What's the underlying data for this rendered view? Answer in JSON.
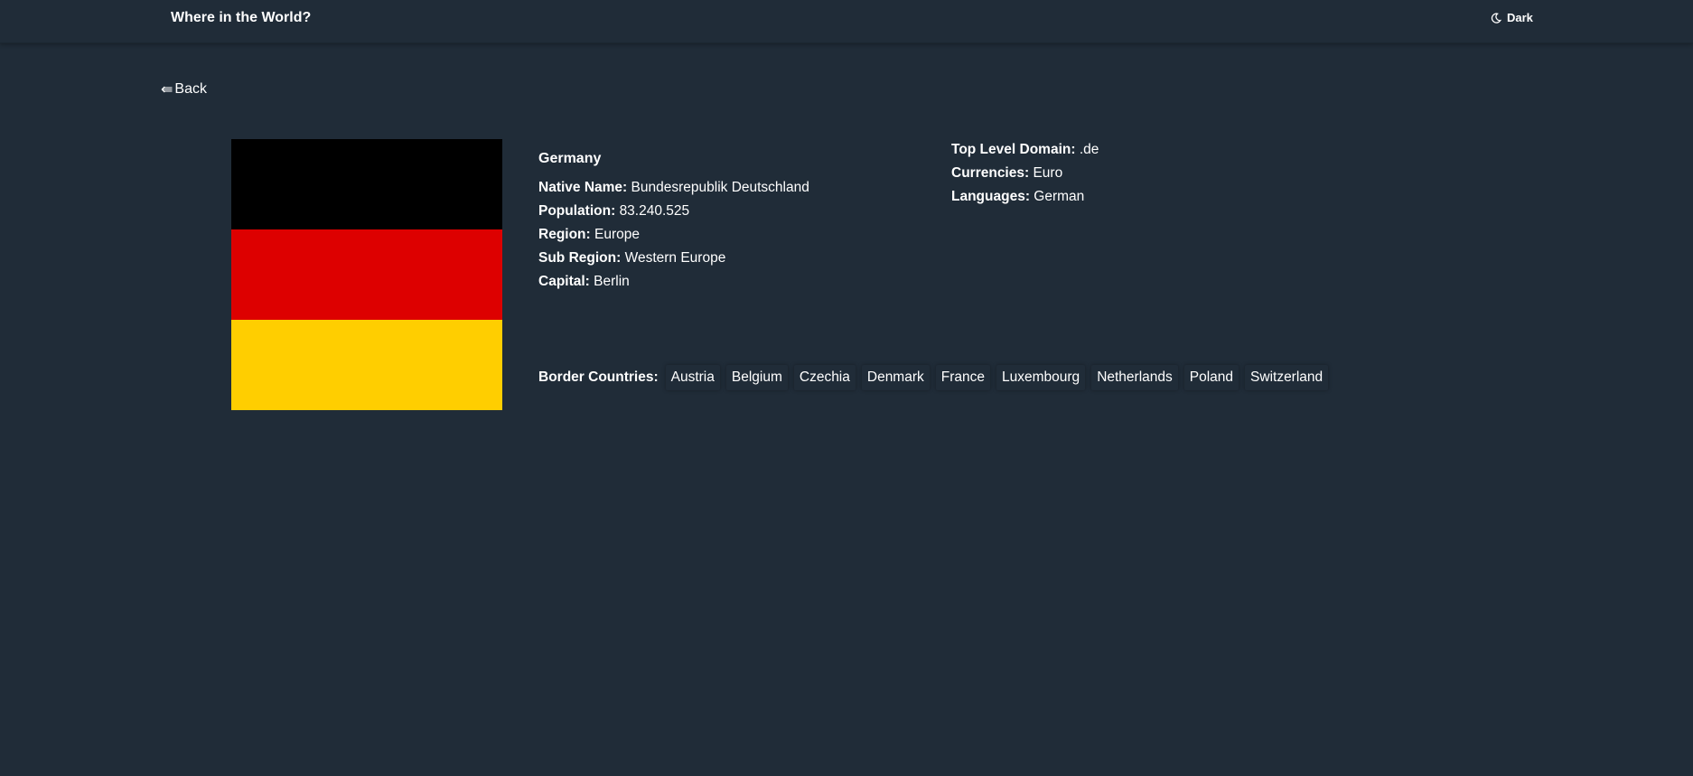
{
  "header": {
    "title": "Where in the World?",
    "theme_label": "Dark"
  },
  "back_label": "Back",
  "country": {
    "name": "Germany",
    "flag_colors": [
      "#000000",
      "#dd0000",
      "#ffce00"
    ],
    "fields_left": [
      {
        "label": "Native Name:",
        "value": "Bundesrepublik Deutschland"
      },
      {
        "label": "Population:",
        "value": "83.240.525"
      },
      {
        "label": "Region:",
        "value": "Europe"
      },
      {
        "label": "Sub Region:",
        "value": "Western Europe"
      },
      {
        "label": "Capital:",
        "value": "Berlin"
      }
    ],
    "fields_right": [
      {
        "label": "Top Level Domain:",
        "value": ".de"
      },
      {
        "label": "Currencies:",
        "value": "Euro"
      },
      {
        "label": "Languages:",
        "value": "German"
      }
    ],
    "borders_label": "Border Countries:",
    "borders": [
      "Austria",
      "Belgium",
      "Czechia",
      "Denmark",
      "France",
      "Luxembourg",
      "Netherlands",
      "Poland",
      "Switzerland"
    ]
  }
}
